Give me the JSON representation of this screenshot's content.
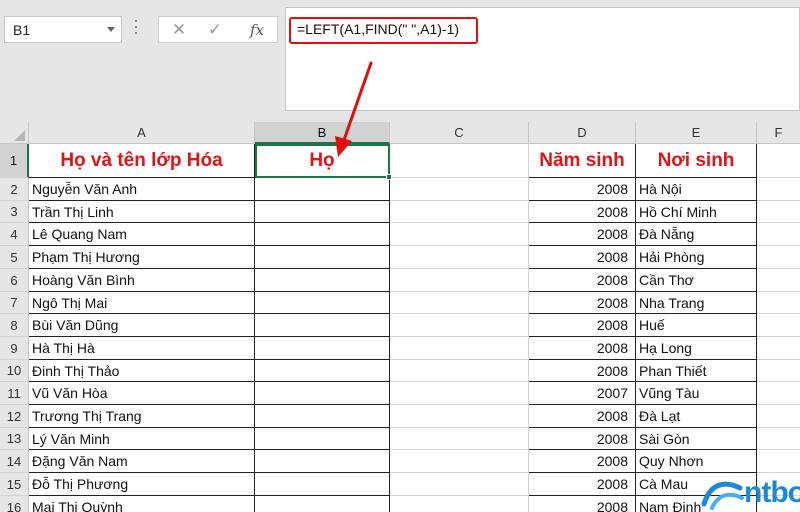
{
  "name_box": {
    "value": "B1"
  },
  "formula_bar": {
    "fx_label": "fx",
    "formula": "=LEFT(A1,FIND(\" \",A1)-1)"
  },
  "columns": [
    "A",
    "B",
    "C",
    "D",
    "E",
    "F"
  ],
  "selected_cell": "B1",
  "header_row": {
    "row_number": "1",
    "a": "Họ và tên lớp Hóa",
    "b": "Họ",
    "c": "",
    "d": "Năm sinh",
    "e": "Nơi sinh"
  },
  "rows": [
    {
      "n": "2",
      "name": "Nguyễn Văn Anh",
      "year": "2008",
      "place": "Hà Nội"
    },
    {
      "n": "3",
      "name": "Trần Thị Linh",
      "year": "2008",
      "place": "Hồ Chí Minh"
    },
    {
      "n": "4",
      "name": "Lê Quang Nam",
      "year": "2008",
      "place": "Đà Nẵng"
    },
    {
      "n": "5",
      "name": "Phạm Thị Hương",
      "year": "2008",
      "place": "Hải Phòng"
    },
    {
      "n": "6",
      "name": "Hoàng Văn Bình",
      "year": "2008",
      "place": "Cần Thơ"
    },
    {
      "n": "7",
      "name": "Ngô Thị Mai",
      "year": "2008",
      "place": "Nha Trang"
    },
    {
      "n": "8",
      "name": "Bùi Văn Dũng",
      "year": "2008",
      "place": "Huế"
    },
    {
      "n": "9",
      "name": "Hà Thị Hà",
      "year": "2008",
      "place": "Hạ Long"
    },
    {
      "n": "10",
      "name": "Đinh Thị Thảo",
      "year": "2008",
      "place": "Phan Thiết"
    },
    {
      "n": "11",
      "name": "Vũ Văn Hòa",
      "year": "2007",
      "place": "Vũng Tàu"
    },
    {
      "n": "12",
      "name": "Trương Thị Trang",
      "year": "2008",
      "place": "Đà Lạt"
    },
    {
      "n": "13",
      "name": "Lý Văn Minh",
      "year": "2008",
      "place": "Sài Gòn"
    },
    {
      "n": "14",
      "name": "Đặng Văn Nam",
      "year": "2008",
      "place": "Quy Nhơn"
    },
    {
      "n": "15",
      "name": "Đỗ Thị Phương",
      "year": "2008",
      "place": "Cà Mau"
    },
    {
      "n": "16",
      "name": "Mai Thị Quỳnh",
      "year": "2008",
      "place": "Nam Định"
    }
  ],
  "colors": {
    "header_text": "#e01414",
    "selection": "#217346",
    "annotation": "#e01010",
    "logo": "#1e88d8"
  },
  "watermark": {
    "text": "ntbook"
  }
}
